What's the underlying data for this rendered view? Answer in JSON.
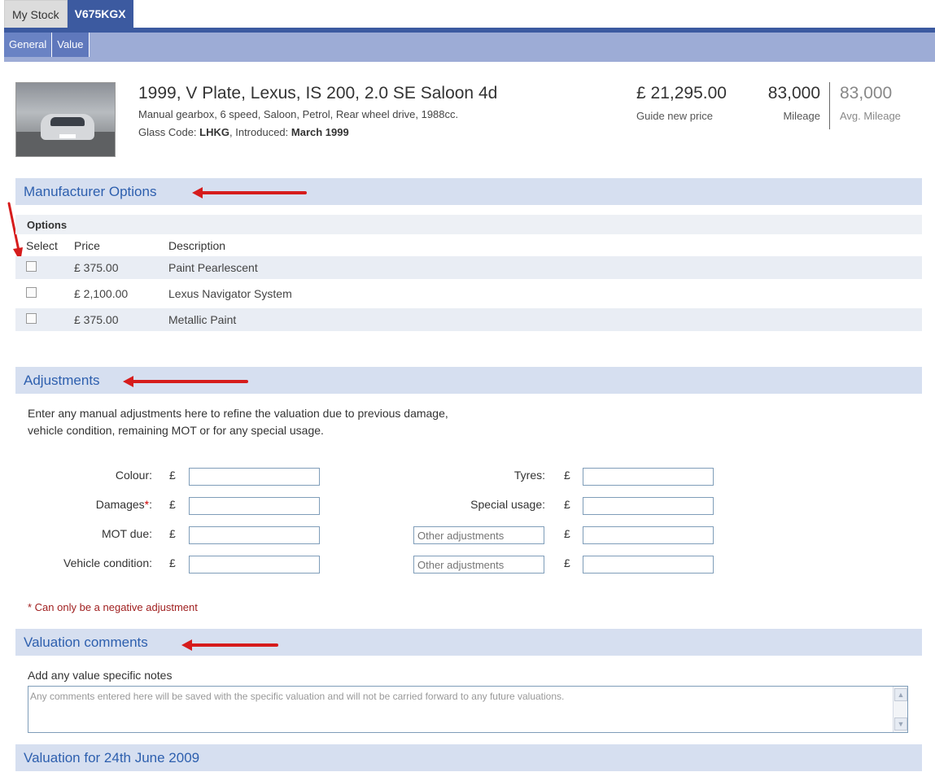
{
  "top_tabs": [
    {
      "label": "My Stock"
    },
    {
      "label": "V675KGX"
    }
  ],
  "sub_tabs": [
    {
      "label": "General"
    },
    {
      "label": "Value"
    }
  ],
  "vehicle": {
    "title": "1999, V Plate, Lexus, IS 200, 2.0 SE Saloon 4d",
    "spec": "Manual gearbox, 6 speed, Saloon, Petrol, Rear wheel drive, 1988cc.",
    "glass_prefix": "Glass Code: ",
    "glass_code": "LHKG",
    "introduced_prefix": ", Introduced: ",
    "introduced": "March 1999"
  },
  "stats": {
    "price_value": "£ 21,295.00",
    "price_label": "Guide new price",
    "mileage_value": "83,000",
    "mileage_label": "Mileage",
    "avg_value": "83,000",
    "avg_label": "Avg. Mileage"
  },
  "sections": {
    "manufacturer": "Manufacturer Options",
    "adjustments": "Adjustments",
    "comments": "Valuation comments",
    "valuation": "Valuation for 24th June 2009"
  },
  "options": {
    "title": "Options",
    "columns": [
      "Select",
      "Price",
      "Description"
    ],
    "rows": [
      {
        "price": "£ 375.00",
        "description": "Paint Pearlescent",
        "checked": false
      },
      {
        "price": "£ 2,100.00",
        "description": "Lexus Navigator System",
        "checked": false
      },
      {
        "price": "£ 375.00",
        "description": "Metallic Paint",
        "checked": false
      }
    ]
  },
  "adjustments": {
    "intro_line1": "Enter any manual adjustments here to refine the valuation due to previous damage,",
    "intro_line2": "vehicle condition, remaining MOT or for any special usage.",
    "currency": "£",
    "left": [
      {
        "label": "Colour:"
      },
      {
        "label": "Damages",
        "required_mark": "*",
        "suffix": ":"
      },
      {
        "label": "MOT due:"
      },
      {
        "label": "Vehicle condition:"
      }
    ],
    "right_labels": [
      "Tyres:",
      "Special usage:"
    ],
    "other_placeholder": "Other adjustments",
    "negative_note": "* Can only be a negative adjustment"
  },
  "comments": {
    "label": "Add any value specific notes",
    "placeholder": "Any comments entered here will be saved with the specific valuation and will not be carried forward to any future valuations."
  },
  "colors": {
    "tab_active": "#3c5aa0",
    "subnav": "#9dacd6",
    "section_bg": "#d6dff0",
    "section_text": "#2d5fae",
    "annotation_arrow": "#d61c1c"
  }
}
